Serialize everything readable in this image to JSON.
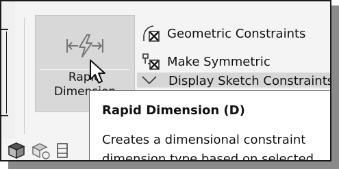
{
  "ribbon": {
    "rapid_dimension": {
      "label_line1": "Rapid",
      "label_line2": "Dimension",
      "icon": "rapid-dimension-icon"
    },
    "constraint_items": [
      {
        "label": "Geometric Constraints",
        "icon": "geometric-constraints-icon"
      },
      {
        "label": "Make Symmetric",
        "icon": "make-symmetric-icon"
      },
      {
        "label": "Display Sketch Constraints",
        "icon": "display-constraints-icon"
      }
    ],
    "bottom_icons": [
      "sketch-cube-icon",
      "display-icon",
      "grid-icon"
    ]
  },
  "tooltip": {
    "title": "Rapid Dimension (D)",
    "line1": "Creates a dimensional constraint",
    "line2": "dimension type based on selected"
  },
  "colors": {
    "button_bg": "#d8d8d8",
    "frame_bg": "#f4f4f4",
    "shadow": "#8a8a8a",
    "text": "#111111"
  }
}
